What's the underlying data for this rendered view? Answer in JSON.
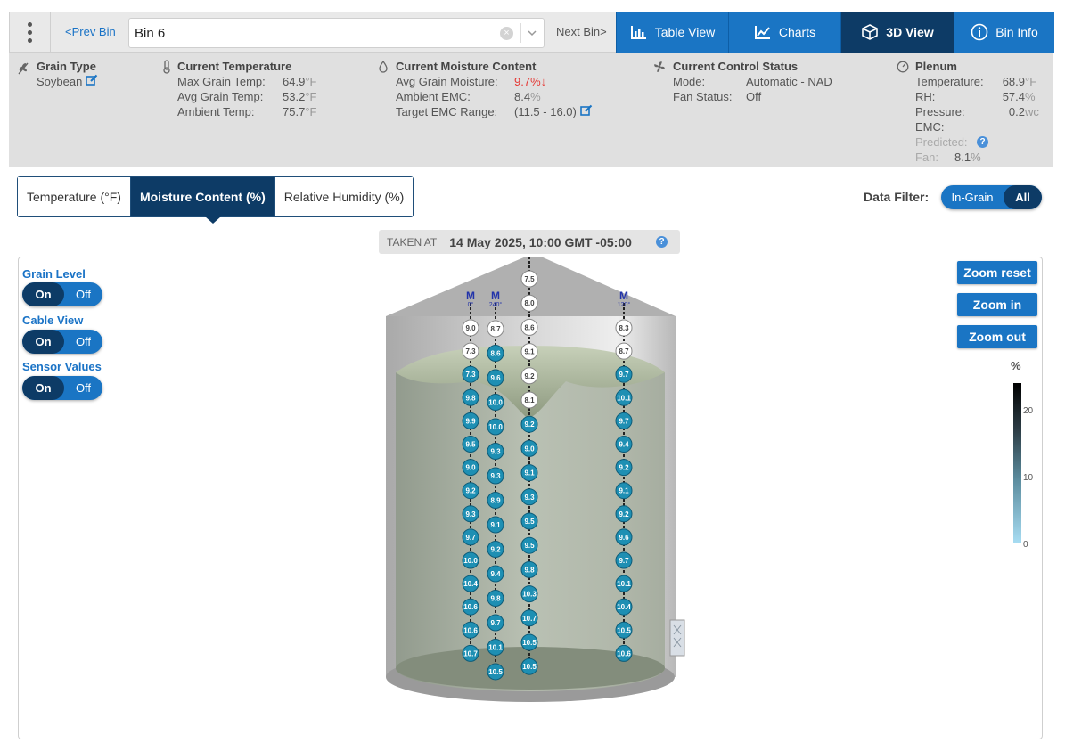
{
  "nav": {
    "prev_label": "<Prev Bin",
    "next_label": "Next Bin>",
    "bin_value": "Bin 6",
    "clear_glyph": "×"
  },
  "views": [
    {
      "label": "Table View",
      "icon": "table-chart-icon",
      "active": false
    },
    {
      "label": "Charts",
      "icon": "line-chart-icon",
      "active": false
    },
    {
      "label": "3D View",
      "icon": "cube-icon",
      "active": true
    },
    {
      "label": "Bin Info",
      "icon": "info-icon",
      "active": false
    }
  ],
  "info": {
    "grain": {
      "title": "Grain Type",
      "value": "Soybean"
    },
    "temperature": {
      "title": "Current Temperature",
      "unit": "°F",
      "rows": [
        {
          "label": "Max Grain Temp:",
          "value": "64.9"
        },
        {
          "label": "Avg Grain Temp:",
          "value": "53.2"
        },
        {
          "label": "Ambient Temp:",
          "value": "75.7"
        }
      ]
    },
    "moisture": {
      "title": "Current Moisture Content",
      "avg_label": "Avg Grain Moisture:",
      "avg_value": "9.7%",
      "avg_arrow": "↓",
      "emc_label": "Ambient EMC:",
      "emc_value": "8.4",
      "emc_unit": "%",
      "range_label": "Target EMC Range:",
      "range_value": "(11.5 - 16.0)"
    },
    "control": {
      "title": "Current Control Status",
      "mode_label": "Mode:",
      "mode_value": "Automatic - NAD",
      "fan_label": "Fan Status:",
      "fan_value": "Off"
    },
    "plenum": {
      "title": "Plenum",
      "temp_label": "Temperature:",
      "temp_value": "68.9",
      "temp_unit": "°F",
      "rh_label": "RH:",
      "rh_value": "57.4",
      "rh_unit": "%",
      "pressure_label": "Pressure:",
      "pressure_value": "0.2",
      "pressure_unit": "wc",
      "emc_label": "EMC:",
      "predicted_label": "Predicted:",
      "fan_label": "Fan:",
      "fan_value": "8.1",
      "fan_unit": "%"
    }
  },
  "measure_tabs": [
    {
      "label": "Temperature (°F)",
      "active": false
    },
    {
      "label": "Moisture Content (%)",
      "active": true
    },
    {
      "label": "Relative Humidity (%)",
      "active": false
    }
  ],
  "filter": {
    "label": "Data Filter:",
    "opt1": "In-Grain",
    "opt2": "All",
    "selected": "All"
  },
  "taken": {
    "label": "TAKEN AT",
    "value": "14 May 2025, 10:00 GMT -05:00",
    "help": "?"
  },
  "toggles": [
    {
      "label": "Grain Level",
      "on": "On",
      "off": "Off",
      "state": "On"
    },
    {
      "label": "Cable View",
      "on": "On",
      "off": "Off",
      "state": "On"
    },
    {
      "label": "Sensor Values",
      "on": "On",
      "off": "Off",
      "state": "On"
    }
  ],
  "zoom": {
    "reset": "Zoom reset",
    "in": "Zoom in",
    "out": "Zoom out"
  },
  "scale": {
    "unit": "%",
    "ticks": [
      "20",
      "10",
      "0"
    ],
    "min": 0,
    "max": 23
  },
  "cables": [
    {
      "marker": "M",
      "angle": "0°",
      "values": [
        "9.0",
        "7.3",
        "7.3",
        "9.8",
        "9.9",
        "9.5",
        "9.0",
        "9.2",
        "9.3",
        "9.7",
        "10.0",
        "10.4",
        "10.6",
        "10.6",
        "10.7"
      ]
    },
    {
      "marker": "M",
      "angle": "240°",
      "values": [
        "8.7",
        "8.6",
        "9.6",
        "10.0",
        "10.0",
        "9.3",
        "9.3",
        "8.9",
        "9.1",
        "9.2",
        "9.4",
        "9.8",
        "9.7",
        "10.1",
        "10.5"
      ]
    },
    {
      "marker": "",
      "angle": "",
      "values": [
        "7.5",
        "8.0",
        "8.6",
        "9.1",
        "9.2",
        "8.1",
        "9.2",
        "9.0",
        "9.1",
        "9.3",
        "9.5",
        "9.5",
        "9.8",
        "10.3",
        "10.7",
        "10.5",
        "10.5"
      ]
    },
    {
      "marker": "M",
      "angle": "120°",
      "values": [
        "8.3",
        "8.7",
        "9.7",
        "10.1",
        "9.7",
        "9.4",
        "9.2",
        "9.1",
        "9.2",
        "9.6",
        "9.7",
        "10.1",
        "10.4",
        "10.5",
        "10.6"
      ]
    }
  ],
  "colors": {
    "brand_blue": "#1a75c4",
    "navy": "#0d3b66",
    "sensor_teal": "#1e8fb3",
    "sensor_white": "#ffffff",
    "alert_red": "#e53935"
  }
}
